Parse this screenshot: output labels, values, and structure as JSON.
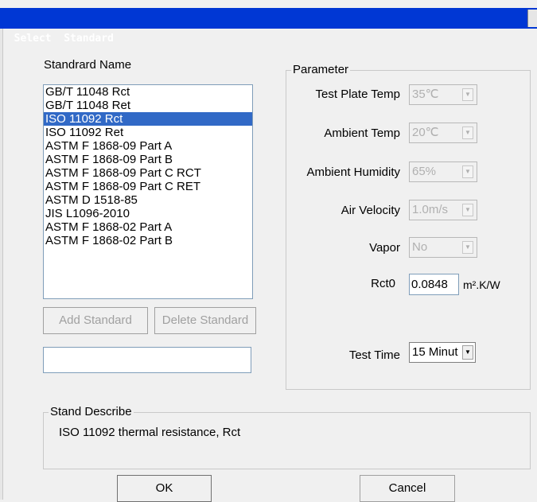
{
  "window": {
    "title": "Select  Standard"
  },
  "standard_list": {
    "heading": "Standrard Name",
    "items": [
      "GB/T 11048 Rct",
      "GB/T 11048 Ret",
      "ISO 11092 Rct",
      "ISO 11092 Ret",
      "ASTM F 1868-09 Part A",
      "ASTM F 1868-09 Part B",
      "ASTM F 1868-09 Part C RCT",
      "ASTM F 1868-09 Part C RET",
      "ASTM D 1518-85",
      "JIS L1096-2010",
      "ASTM F 1868-02 Part A",
      "ASTM F 1868-02 Part B"
    ],
    "selected": "ISO 11092 Rct"
  },
  "buttons": {
    "add_standard": "Add Standard",
    "delete_standard": "Delete Standard",
    "ok": "OK",
    "cancel": "Cancel"
  },
  "name_input": {
    "value": ""
  },
  "parameter": {
    "legend": "Parameter",
    "test_plate_temp": {
      "label": "Test Plate Temp",
      "value": "35℃"
    },
    "ambient_temp": {
      "label": "Ambient Temp",
      "value": "20℃"
    },
    "ambient_humidity": {
      "label": "Ambient Humidity",
      "value": "65%"
    },
    "air_velocity": {
      "label": "Air Velocity",
      "value": "1.0m/s"
    },
    "vapor": {
      "label": "Vapor",
      "value": "No"
    },
    "rct0": {
      "label": "Rct0",
      "value": "0.0848",
      "unit": "m².K/W"
    },
    "test_time": {
      "label": "Test Time",
      "value": "15 Minut"
    }
  },
  "describe": {
    "legend": "Stand Describe",
    "text": "ISO 11092 thermal resistance, Rct"
  }
}
